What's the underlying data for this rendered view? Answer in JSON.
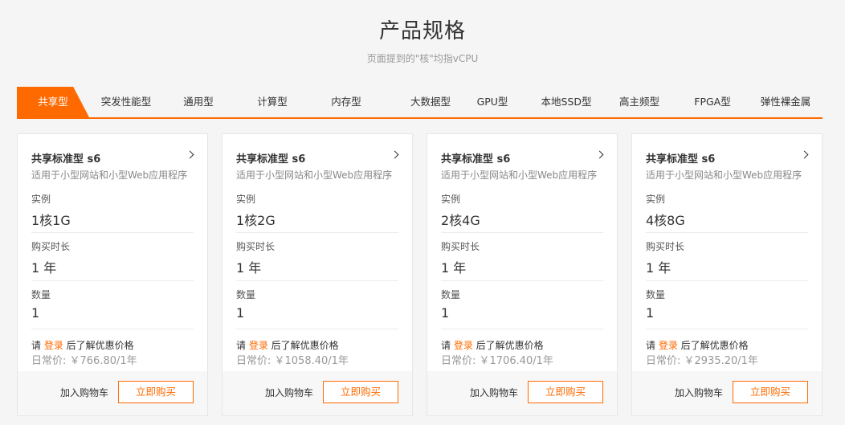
{
  "header": {
    "title": "产品规格",
    "subtitle": "页面提到的\"核\"均指vCPU"
  },
  "tabs": [
    {
      "label": "共享型",
      "active": true
    },
    {
      "label": "突发性能型"
    },
    {
      "label": "通用型"
    },
    {
      "label": "计算型"
    },
    {
      "label": "内存型"
    },
    {
      "label": "大数据型"
    },
    {
      "label": "GPU型"
    },
    {
      "label": "本地SSD型"
    },
    {
      "label": "高主频型"
    },
    {
      "label": "FPGA型"
    },
    {
      "label": "弹性裸金属"
    }
  ],
  "colors": {
    "accent": "#ff6a00",
    "background": "#f5f5f5"
  },
  "cards": [
    {
      "name": "共享标准型 s6",
      "desc": "适用于小型网站和小型Web应用程序",
      "instance_label": "实例",
      "instance": "1核1G",
      "duration_label": "购买时长",
      "duration": "1 年",
      "quantity_label": "数量",
      "quantity": "1",
      "login_prefix": "请 ",
      "login_link": "登录",
      "login_suffix": " 后了解优惠价格",
      "price": "日常价: ￥766.80/1年",
      "cart": "加入购物车",
      "buy": "立即购买"
    },
    {
      "name": "共享标准型 s6",
      "desc": "适用于小型网站和小型Web应用程序",
      "instance_label": "实例",
      "instance": "1核2G",
      "duration_label": "购买时长",
      "duration": "1 年",
      "quantity_label": "数量",
      "quantity": "1",
      "login_prefix": "请 ",
      "login_link": "登录",
      "login_suffix": " 后了解优惠价格",
      "price": "日常价: ￥1058.40/1年",
      "cart": "加入购物车",
      "buy": "立即购买"
    },
    {
      "name": "共享标准型 s6",
      "desc": "适用于小型网站和小型Web应用程序",
      "instance_label": "实例",
      "instance": "2核4G",
      "duration_label": "购买时长",
      "duration": "1 年",
      "quantity_label": "数量",
      "quantity": "1",
      "login_prefix": "请 ",
      "login_link": "登录",
      "login_suffix": " 后了解优惠价格",
      "price": "日常价: ￥1706.40/1年",
      "cart": "加入购物车",
      "buy": "立即购买"
    },
    {
      "name": "共享标准型 s6",
      "desc": "适用于小型网站和小型Web应用程序",
      "instance_label": "实例",
      "instance": "4核8G",
      "duration_label": "购买时长",
      "duration": "1 年",
      "quantity_label": "数量",
      "quantity": "1",
      "login_prefix": "请 ",
      "login_link": "登录",
      "login_suffix": " 后了解优惠价格",
      "price": "日常价: ￥2935.20/1年",
      "cart": "加入购物车",
      "buy": "立即购买"
    }
  ]
}
